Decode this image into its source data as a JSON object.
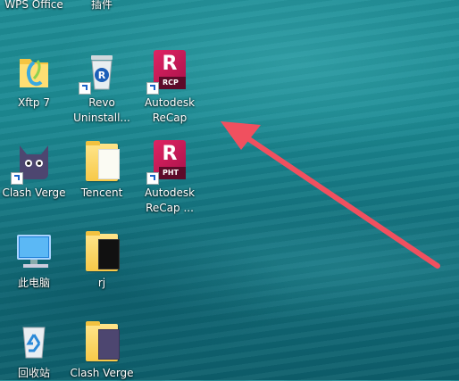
{
  "desktop": {
    "icons": [
      {
        "label": "WPS Office"
      },
      {
        "label": "插件"
      },
      {
        "label": "Xftp 7"
      },
      {
        "label": "Revo\nUninstall..."
      },
      {
        "label": "Autodesk\nReCap",
        "badge": "RCP"
      },
      {
        "label": "Clash Verge"
      },
      {
        "label": "Tencent"
      },
      {
        "label": "Autodesk\nReCap ...",
        "badge": "PHT"
      },
      {
        "label": "此电脑"
      },
      {
        "label": "rj"
      },
      {
        "label": "回收站"
      },
      {
        "label": "Clash Verge"
      }
    ]
  },
  "annotation": {
    "arrow_color": "#f0505f"
  },
  "colors": {
    "autodesk": "#d6205e",
    "folder": "#f7c948"
  }
}
